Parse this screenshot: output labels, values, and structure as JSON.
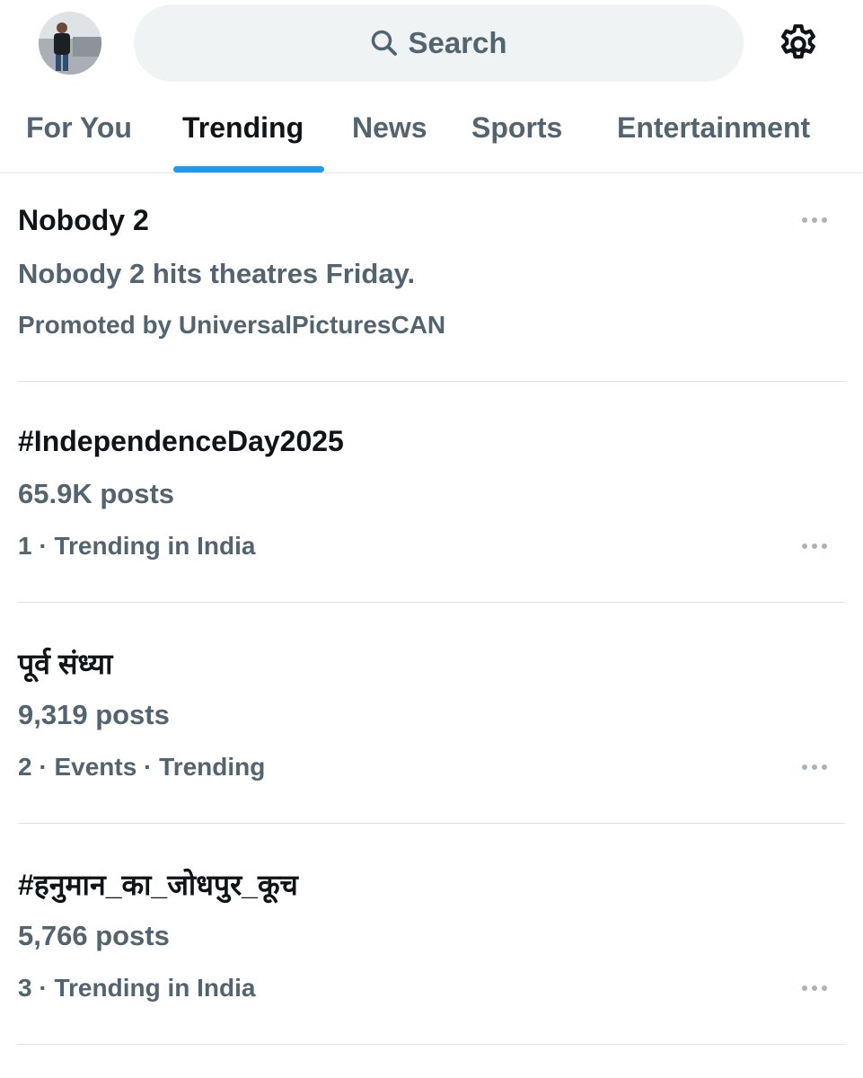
{
  "search": {
    "label": "Search",
    "icon": "search-icon"
  },
  "settings": {
    "icon": "gear-icon"
  },
  "tabs": [
    {
      "label": "For You",
      "active": false
    },
    {
      "label": "Trending",
      "active": true
    },
    {
      "label": "News",
      "active": false
    },
    {
      "label": "Sports",
      "active": false
    },
    {
      "label": "Entertainment",
      "active": false
    }
  ],
  "colors": {
    "accent": "#1d9bf0",
    "secondary_text": "#536471",
    "primary_text": "#0f1419",
    "search_bg": "#eff3f4"
  },
  "trends": [
    {
      "title": "Nobody 2",
      "subtitle": "Nobody 2 hits theatres Friday.",
      "meta": "Promoted by UniversalPicturesCAN"
    },
    {
      "title": "#IndependenceDay2025",
      "subtitle": "65.9K posts",
      "meta": "1 · Trending in India"
    },
    {
      "title": "पूर्व संध्या",
      "subtitle": "9,319 posts",
      "meta": "2 · Events · Trending"
    },
    {
      "title": "#हनुमान_का_जोधपुर_कूच",
      "subtitle": "5,766 posts",
      "meta": "3 · Trending in India"
    }
  ]
}
